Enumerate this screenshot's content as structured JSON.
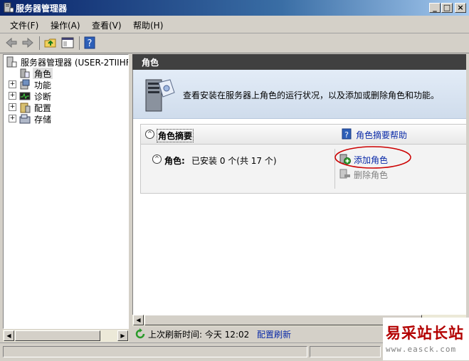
{
  "window": {
    "title": "服务器管理器"
  },
  "caption_buttons": {
    "minimize": "_",
    "maximize": "□",
    "close": "×"
  },
  "menu": [
    {
      "label": "文件(F)"
    },
    {
      "label": "操作(A)"
    },
    {
      "label": "查看(V)"
    },
    {
      "label": "帮助(H)"
    }
  ],
  "toolbar": {
    "icons": [
      "back-arrow-icon",
      "forward-arrow-icon",
      "up-folder-icon",
      "show-hide-tree-icon",
      "help-icon"
    ],
    "help_glyph": "?"
  },
  "tree": {
    "root": "服务器管理器 (USER-2TIIHF",
    "items": [
      {
        "label": "角色",
        "icon": "roles-icon",
        "expandable": false,
        "selected": true
      },
      {
        "label": "功能",
        "icon": "features-icon",
        "expandable": true
      },
      {
        "label": "诊断",
        "icon": "diagnostics-icon",
        "expandable": true
      },
      {
        "label": "配置",
        "icon": "configuration-icon",
        "expandable": true
      },
      {
        "label": "存储",
        "icon": "storage-icon",
        "expandable": true
      }
    ],
    "expand_glyph": "+"
  },
  "main": {
    "header": "角色",
    "description": "查看安装在服务器上角色的运行状况，以及添加或删除角色和功能。",
    "summary": {
      "title": "角色摘要",
      "help_link": "角色摘要帮助",
      "help_glyph": "?",
      "roles_label": "角色:",
      "roles_text": "已安装 0 个(共 17 个)",
      "collapse_glyph": "^",
      "actions": [
        {
          "label": "添加角色",
          "icon": "add-role-icon",
          "highlighted": true
        },
        {
          "label": "删除角色",
          "icon": "remove-role-icon",
          "enabled": false
        }
      ]
    }
  },
  "status": {
    "refresh_text": "上次刷新时间: 今天 12:02",
    "configure_link": "配置刷新"
  },
  "watermark": {
    "brand": "易采站长站",
    "url": "www.easck.com"
  },
  "colors": {
    "title_bar": "#0a246a",
    "header_bar": "#404040",
    "link": "#0a2aa8",
    "highlight_ellipse": "#cc0000",
    "watermark": "#b30000"
  }
}
